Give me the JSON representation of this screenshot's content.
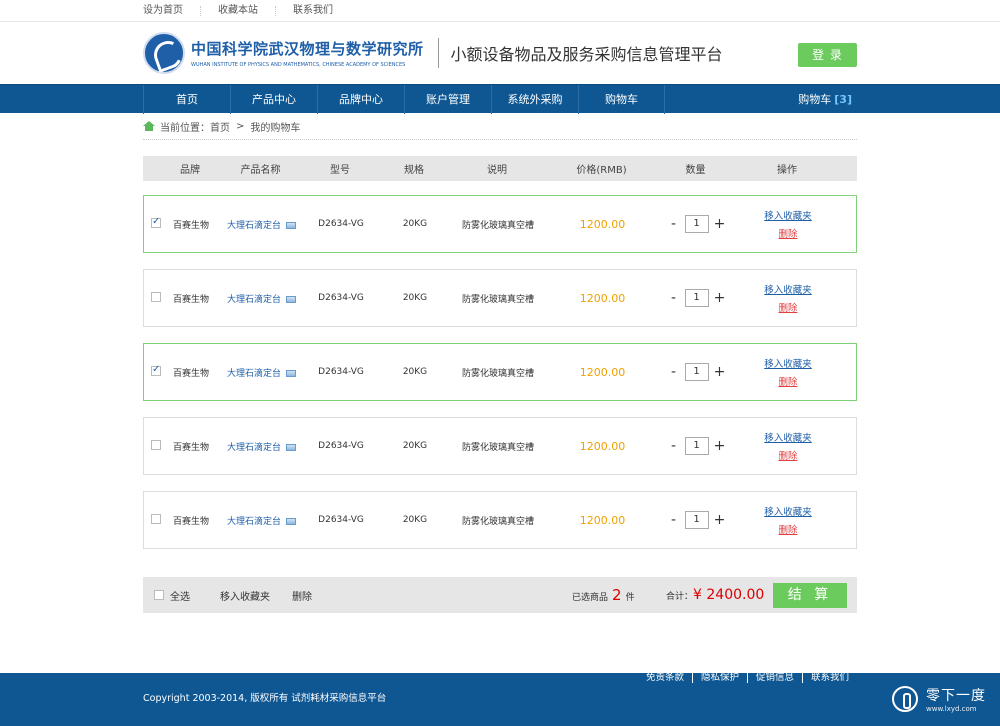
{
  "topbar": {
    "links": [
      "设为首页",
      "收藏本站",
      "联系我们"
    ]
  },
  "header": {
    "logo_cn": "中国科学院武汉物理与数学研究所",
    "logo_en": "WUHAN INSTITUTE OF PHYSICS AND MATHEMATICS,  CHINESE ACADEMY OF SCIENCES",
    "platform": "小额设备物品及服务采购信息管理平台",
    "login_label": "登 录"
  },
  "nav": {
    "items": [
      "首页",
      "产品中心",
      "品牌中心",
      "账户管理",
      "系统外采购",
      "购物车"
    ],
    "cart_label": "购物车",
    "cart_count": "[3]"
  },
  "breadcrumb": {
    "prefix": "当前位置：",
    "home": "首页",
    "sep": ">",
    "current": "我的购物车"
  },
  "table": {
    "headers": [
      "品牌",
      "产品名称",
      "型号",
      "规格",
      "说明",
      "价格(RMB)",
      "数量",
      "操作"
    ],
    "rows": [
      {
        "checked": true,
        "brand": "百赛生物",
        "name": "大理石滴定台",
        "model": "D2634-VG",
        "spec": "20KG",
        "desc": "防雾化玻璃真空槽",
        "price": "1200.00",
        "qty": "1"
      },
      {
        "checked": false,
        "brand": "百赛生物",
        "name": "大理石滴定台",
        "model": "D2634-VG",
        "spec": "20KG",
        "desc": "防雾化玻璃真空槽",
        "price": "1200.00",
        "qty": "1"
      },
      {
        "checked": true,
        "brand": "百赛生物",
        "name": "大理石滴定台",
        "model": "D2634-VG",
        "spec": "20KG",
        "desc": "防雾化玻璃真空槽",
        "price": "1200.00",
        "qty": "1"
      },
      {
        "checked": false,
        "brand": "百赛生物",
        "name": "大理石滴定台",
        "model": "D2634-VG",
        "spec": "20KG",
        "desc": "防雾化玻璃真空槽",
        "price": "1200.00",
        "qty": "1"
      },
      {
        "checked": false,
        "brand": "百赛生物",
        "name": "大理石滴定台",
        "model": "D2634-VG",
        "spec": "20KG",
        "desc": "防雾化玻璃真空槽",
        "price": "1200.00",
        "qty": "1"
      }
    ],
    "op_fav": "移入收藏夹",
    "op_del": "删除",
    "minus": "-",
    "plus": "+"
  },
  "summary": {
    "select_all": "全选",
    "move_fav": "移入收藏夹",
    "delete": "删除",
    "selected_prefix": "已选商品",
    "selected_count": "2",
    "selected_suffix": "件",
    "total_label": "合计：",
    "total_value": "¥ 2400.00",
    "checkout": "结 算"
  },
  "footer": {
    "copyright": "Copyright 2003-2014, 版权所有 试剂耗材采购信息平台",
    "links": [
      "免责条款",
      "隐私保护",
      "促销信息",
      "联系我们"
    ],
    "watermark_title": "零下一度",
    "watermark_url": "www.lxyd.com"
  },
  "colors": {
    "primary": "#0f5792",
    "accent_green": "#6ccb5d",
    "price": "#f0a000",
    "total": "#dd0000",
    "link": "#1f5fa8"
  }
}
